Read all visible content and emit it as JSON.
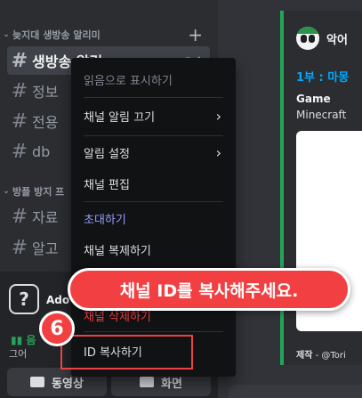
{
  "sidebar": {
    "categories": [
      {
        "label": "늦지대 생방송 알리미",
        "add": "+"
      },
      {
        "label": "방플 방지 프"
      }
    ],
    "channels": [
      {
        "name": "생방송 알림",
        "tools": "⚙ ✱"
      },
      {
        "name": "정보"
      },
      {
        "name": "전용"
      },
      {
        "name": "db"
      },
      {
        "name": "자료"
      },
      {
        "name": "알고"
      }
    ]
  },
  "user": {
    "avatar_glyph": "?",
    "name": "Ado",
    "voice_status": "음",
    "voice_sub": "그어",
    "video_button": "동영상",
    "screen_button": "화면"
  },
  "embed": {
    "bot_name": "악어",
    "title": "1부 : 마몽",
    "field_name": "Game",
    "field_value": "Minecraft",
    "footer_label": "제작",
    "footer_value": " - @Tori"
  },
  "context_menu": {
    "mark_read": "읽음으로 표시하기",
    "mute_channel": "채널 알림 끄기",
    "notification_settings": "알림 설정",
    "edit_channel": "채널 편집",
    "invite": "초대하기",
    "clone_channel": "채널 복제하기",
    "delete_channel": "채널 삭제하기",
    "copy_id": "ID 복사하기",
    "arrow": "›"
  },
  "annotation": {
    "banner_text": "채널 ID를 복사해주세요.",
    "step_number": "6"
  },
  "colors": {
    "accent_red": "#f23f42",
    "embed_green": "#23a55a",
    "link_blue": "#00a8fc"
  }
}
